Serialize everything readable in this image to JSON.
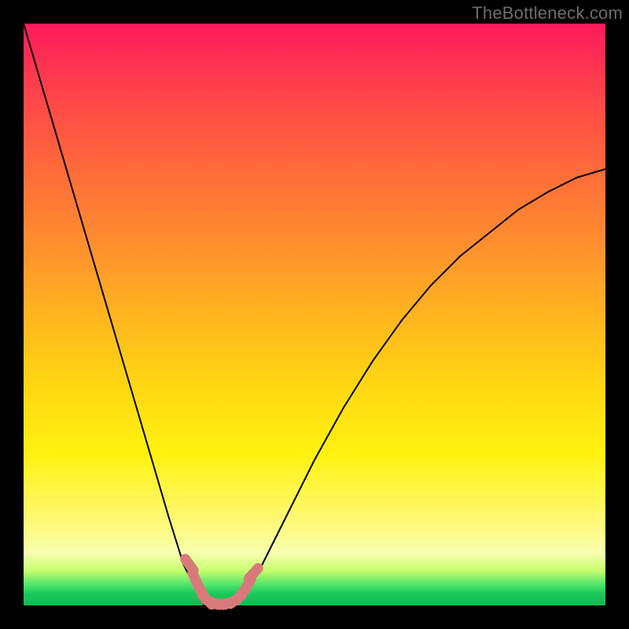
{
  "watermark": "TheBottleneck.com",
  "chart_data": {
    "type": "line",
    "title": "",
    "xlabel": "",
    "ylabel": "",
    "xlim": [
      0,
      1
    ],
    "ylim": [
      0,
      1
    ],
    "series": [
      {
        "name": "bottleneck-curve",
        "x": [
          0.0,
          0.05,
          0.1,
          0.15,
          0.2,
          0.25,
          0.275,
          0.3,
          0.31,
          0.32,
          0.34,
          0.36,
          0.38,
          0.4,
          0.45,
          0.5,
          0.55,
          0.6,
          0.65,
          0.7,
          0.75,
          0.8,
          0.85,
          0.9,
          0.95,
          1.0
        ],
        "values": [
          1.0,
          0.83,
          0.66,
          0.49,
          0.32,
          0.15,
          0.07,
          0.02,
          0.0,
          0.0,
          0.0,
          0.0,
          0.02,
          0.05,
          0.15,
          0.25,
          0.34,
          0.42,
          0.49,
          0.55,
          0.6,
          0.64,
          0.68,
          0.71,
          0.735,
          0.75
        ],
        "color": "#000000"
      }
    ],
    "markers": {
      "name": "highlight-segment",
      "color": "#d97a7a",
      "x": [
        0.285,
        0.295,
        0.305,
        0.315,
        0.325,
        0.335,
        0.345,
        0.355,
        0.365,
        0.375,
        0.385,
        0.395
      ],
      "values": [
        0.07,
        0.045,
        0.025,
        0.01,
        0.005,
        0.003,
        0.003,
        0.005,
        0.01,
        0.02,
        0.035,
        0.055
      ]
    }
  },
  "colors": {
    "top": "#ff1a5b",
    "mid": "#ffd612",
    "bottom": "#13ba52",
    "frame": "#000000",
    "curve": "#000000",
    "marker": "#d97a7a"
  }
}
